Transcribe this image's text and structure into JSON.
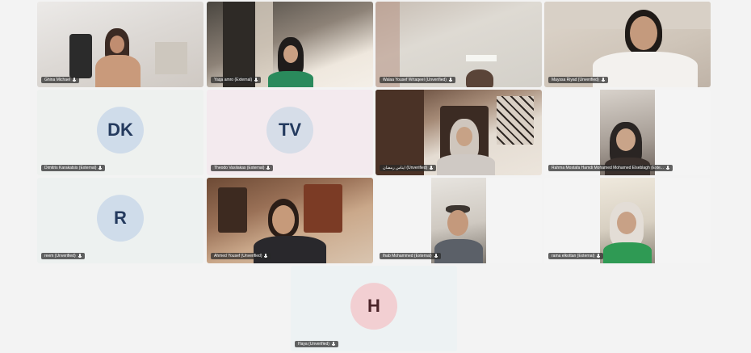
{
  "participants": [
    {
      "name": "Ghina Michael",
      "initials": ""
    },
    {
      "name": "Yaqa amro (External)",
      "initials": ""
    },
    {
      "name": "Walaa Yousef Wrtaqeel (Unverified)",
      "initials": ""
    },
    {
      "name": "Mayssa Riyad (Unverified)",
      "initials": ""
    },
    {
      "name": "Dimitris Karakatsis (External)",
      "initials": "DK"
    },
    {
      "name": "Theodo Vasilakas (External)",
      "initials": "TV"
    },
    {
      "name": "ايناس رمضان (Unverified)",
      "initials": ""
    },
    {
      "name": "Rahma Mostafa Hamdi Mohamed Mohamed Elseblagh (Exte...",
      "initials": ""
    },
    {
      "name": "reem (Unverified)",
      "initials": "R"
    },
    {
      "name": "Ahmed Yousef (Unverified)",
      "initials": ""
    },
    {
      "name": "Ihab Mohammed (External)",
      "initials": ""
    },
    {
      "name": "rama elkottan (External)",
      "initials": ""
    },
    {
      "name": "Haya (Unverified)",
      "initials": "H"
    }
  ],
  "colors": {
    "background": "#f3f3f3",
    "avatar_bg_blue": "#cfdcea",
    "avatar_bg_pink": "#f2cfd2",
    "avatar_text": "#243a5e",
    "nametag_bg": "#3a3a3a"
  },
  "icons": {
    "nametag_icon": "microphone-icon"
  }
}
